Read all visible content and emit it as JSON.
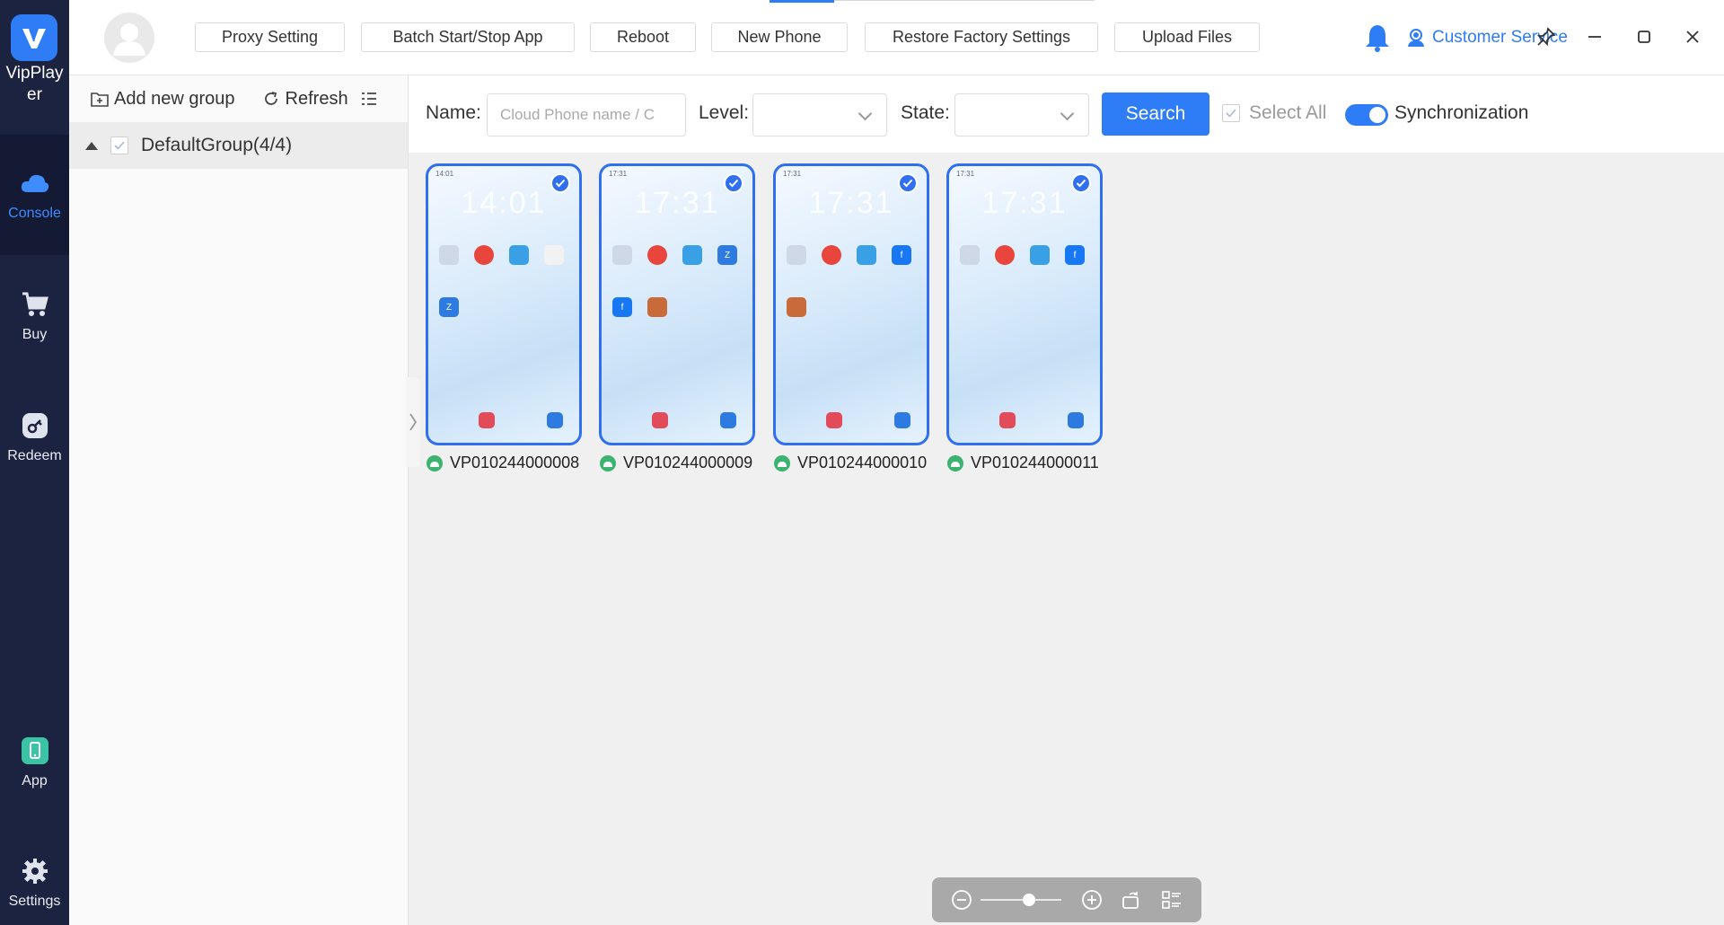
{
  "app": {
    "name": "VipPlayer"
  },
  "rail": {
    "items": [
      {
        "label": "Console",
        "icon": "cloud-icon",
        "active": true
      },
      {
        "label": "Buy",
        "icon": "cart-icon",
        "active": false
      },
      {
        "label": "Redeem",
        "icon": "key-icon",
        "active": false
      },
      {
        "label": "App",
        "icon": "phone-app-icon",
        "active": false
      },
      {
        "label": "Settings",
        "icon": "gear-icon",
        "active": false
      }
    ]
  },
  "toolbar": {
    "buttons": [
      "Proxy Setting",
      "Batch Start/Stop App",
      "Reboot",
      "New Phone",
      "Restore Factory Settings",
      "Upload Files"
    ],
    "customer_service": "Customer Service"
  },
  "groups": {
    "add_label": "Add new group",
    "refresh_label": "Refresh",
    "items": [
      {
        "label": "DefaultGroup(4/4)"
      }
    ]
  },
  "filter": {
    "name_label": "Name:",
    "name_placeholder": "Cloud Phone name / C",
    "level_label": "Level:",
    "level_value": "",
    "state_label": "State:",
    "state_value": "",
    "search_label": "Search",
    "select_all_label": "Select All",
    "sync_label": "Synchronization",
    "sync_on": true
  },
  "phones": [
    {
      "id": "VP010244000008",
      "clock": "14:01",
      "selected": true
    },
    {
      "id": "VP010244000009",
      "clock": "17:31",
      "selected": true
    },
    {
      "id": "VP010244000010",
      "clock": "17:31",
      "selected": true
    },
    {
      "id": "VP010244000011",
      "clock": "17:31",
      "selected": true
    }
  ],
  "zoom": {
    "level": 0.6
  },
  "colors": {
    "accent": "#2f7df6",
    "rail_bg": "#1c2340"
  }
}
